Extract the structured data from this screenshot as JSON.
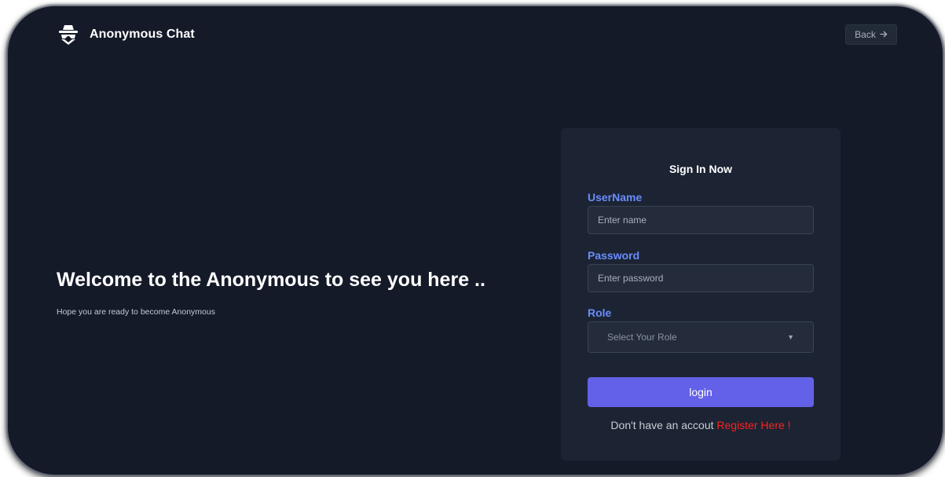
{
  "header": {
    "brand_name": "Anonymous Chat",
    "brand_icon": "incognito-spy-icon",
    "back_label": "Back",
    "back_icon": "arrow-right-icon"
  },
  "hero": {
    "title": "Welcome to the Anonymous to see you here ..",
    "subtitle": "Hope you are ready to become Anonymous"
  },
  "sign_in": {
    "title": "Sign In Now",
    "username_label": "UserName",
    "username_placeholder": "Enter name",
    "password_label": "Password",
    "password_placeholder": "Enter password",
    "role_label": "Role",
    "role_placeholder": "Select Your Role",
    "login_label": "login",
    "register_prompt": "Don't have an accout",
    "register_link": "Register Here !"
  },
  "colors": {
    "background": "#141a28",
    "card": "#1c2433",
    "label_accent": "#6b8cff",
    "primary_button": "#6361e8",
    "link_red": "#ff1f1f"
  }
}
